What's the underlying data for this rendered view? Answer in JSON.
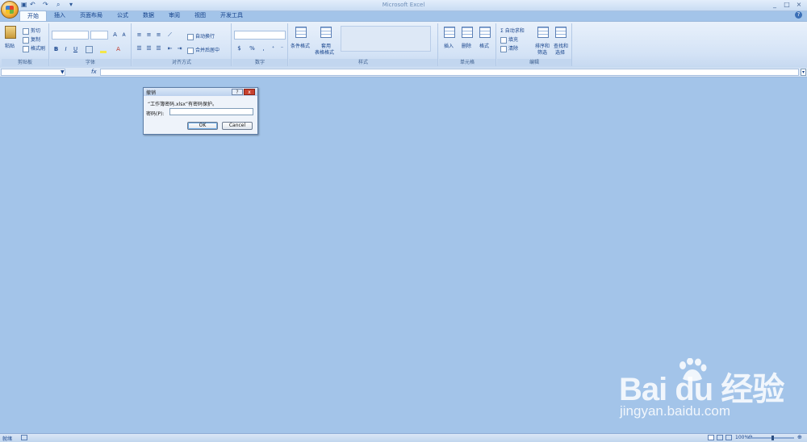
{
  "window": {
    "title": "Microsoft Excel",
    "controls": [
      "_",
      "□",
      "×"
    ]
  },
  "quick_access": [
    "save-icon",
    "undo-icon",
    "redo-icon",
    "print-preview-icon",
    "customize-icon"
  ],
  "tabs": [
    {
      "label": "开始",
      "active": true
    },
    {
      "label": "插入"
    },
    {
      "label": "页面布局"
    },
    {
      "label": "公式"
    },
    {
      "label": "数据"
    },
    {
      "label": "审阅"
    },
    {
      "label": "视图"
    },
    {
      "label": "开发工具"
    }
  ],
  "ribbon": {
    "clipboard": {
      "label": "剪贴板",
      "paste": "粘贴",
      "cut": "剪切",
      "copy": "复制",
      "format_painter": "格式刷"
    },
    "font": {
      "label": "字体",
      "bold": "B",
      "italic": "I",
      "underline": "U",
      "grow": "A",
      "shrink": "A"
    },
    "alignment": {
      "label": "对齐方式",
      "wrap_text": "自动换行",
      "merge_center": "合并后居中"
    },
    "number": {
      "label": "数字",
      "percent": "%"
    },
    "styles": {
      "label": "样式",
      "conditional_format": "条件格式",
      "format_as_table_1": "套用",
      "format_as_table_2": "表格格式"
    },
    "cells": {
      "label": "单元格",
      "insert": "插入",
      "delete": "删除",
      "format": "格式"
    },
    "editing": {
      "label": "编辑",
      "autosum": "自动求和",
      "fill": "填充",
      "clear": "清除",
      "sort_filter_1": "排序和",
      "sort_filter_2": "筛选",
      "find_select_1": "查找和",
      "find_select_2": "选择"
    }
  },
  "formula_bar": {
    "fx": "fx",
    "name_box": "",
    "formula": ""
  },
  "dialog": {
    "title": "撤销",
    "help": "?",
    "close": "x",
    "message": "“工作簿密码.xlsx”有密码保护。",
    "password_label": "密码(P):",
    "password_value": "",
    "ok_label": "OK",
    "cancel_label": "Cancel"
  },
  "statusbar": {
    "status": "就绪",
    "zoom": "100%"
  },
  "watermark": {
    "logo_text": "Bai  du 经验",
    "url": "jingyan.baidu.com"
  }
}
